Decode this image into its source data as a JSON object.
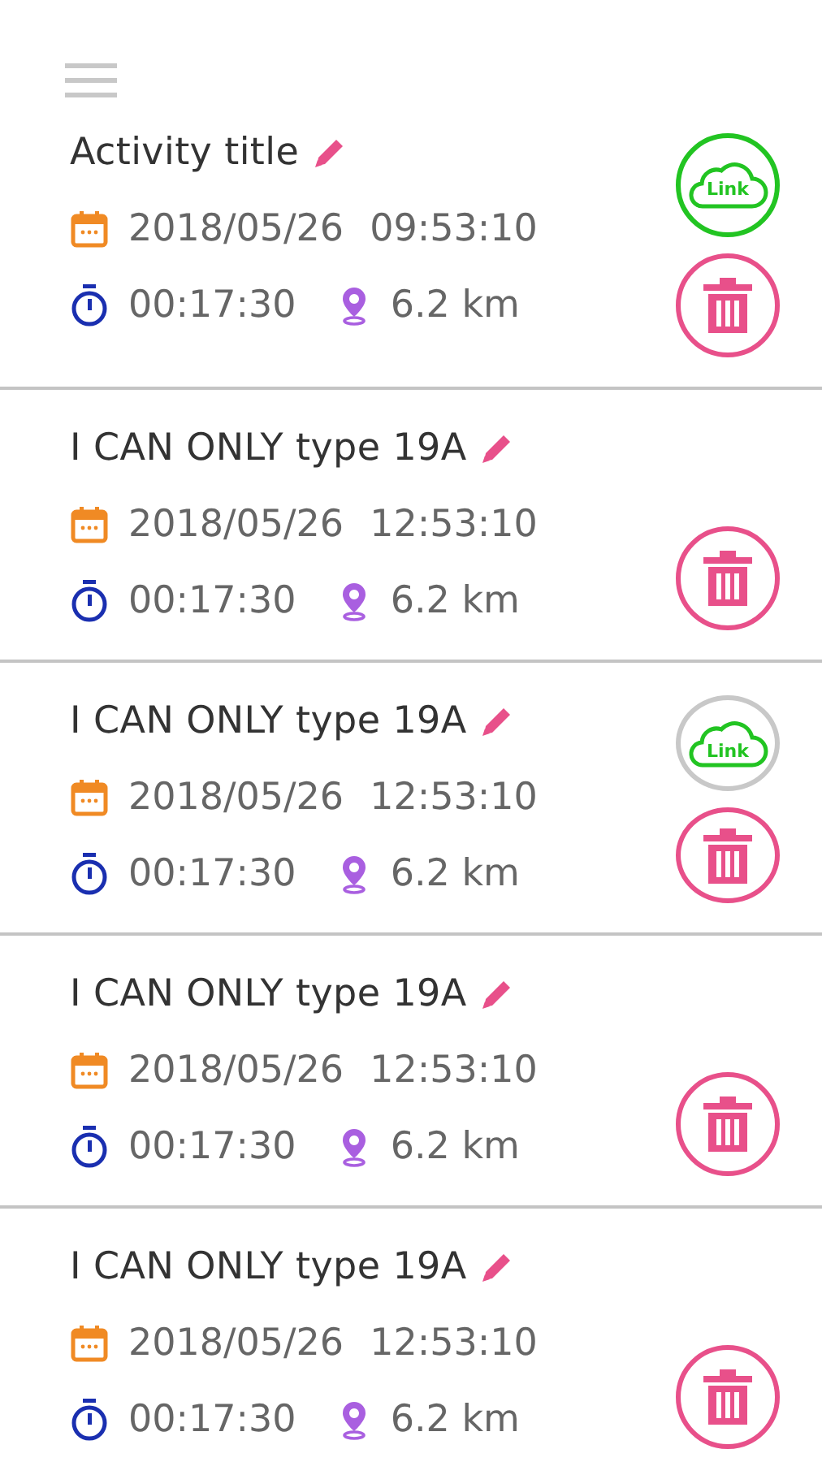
{
  "activities": [
    {
      "title": "Activity title",
      "date": "2018/05/26",
      "time": "09:53:10",
      "duration": "00:17:30",
      "distance": "6.2 km",
      "link": {
        "label": "Link",
        "linked": true
      }
    },
    {
      "title": "I CAN ONLY type 19A",
      "date": "2018/05/26",
      "time": "12:53:10",
      "duration": "00:17:30",
      "distance": "6.2 km"
    },
    {
      "title": "I CAN ONLY type 19A",
      "date": "2018/05/26",
      "time": "12:53:10",
      "duration": "00:17:30",
      "distance": "6.2 km",
      "link": {
        "label": "Link",
        "linked": false
      }
    },
    {
      "title": "I CAN ONLY type 19A",
      "date": "2018/05/26",
      "time": "12:53:10",
      "duration": "00:17:30",
      "distance": "6.2 km"
    },
    {
      "title": "I CAN ONLY type 19A",
      "date": "2018/05/26",
      "time": "12:53:10",
      "duration": "00:17:30",
      "distance": "6.2 km"
    }
  ]
}
